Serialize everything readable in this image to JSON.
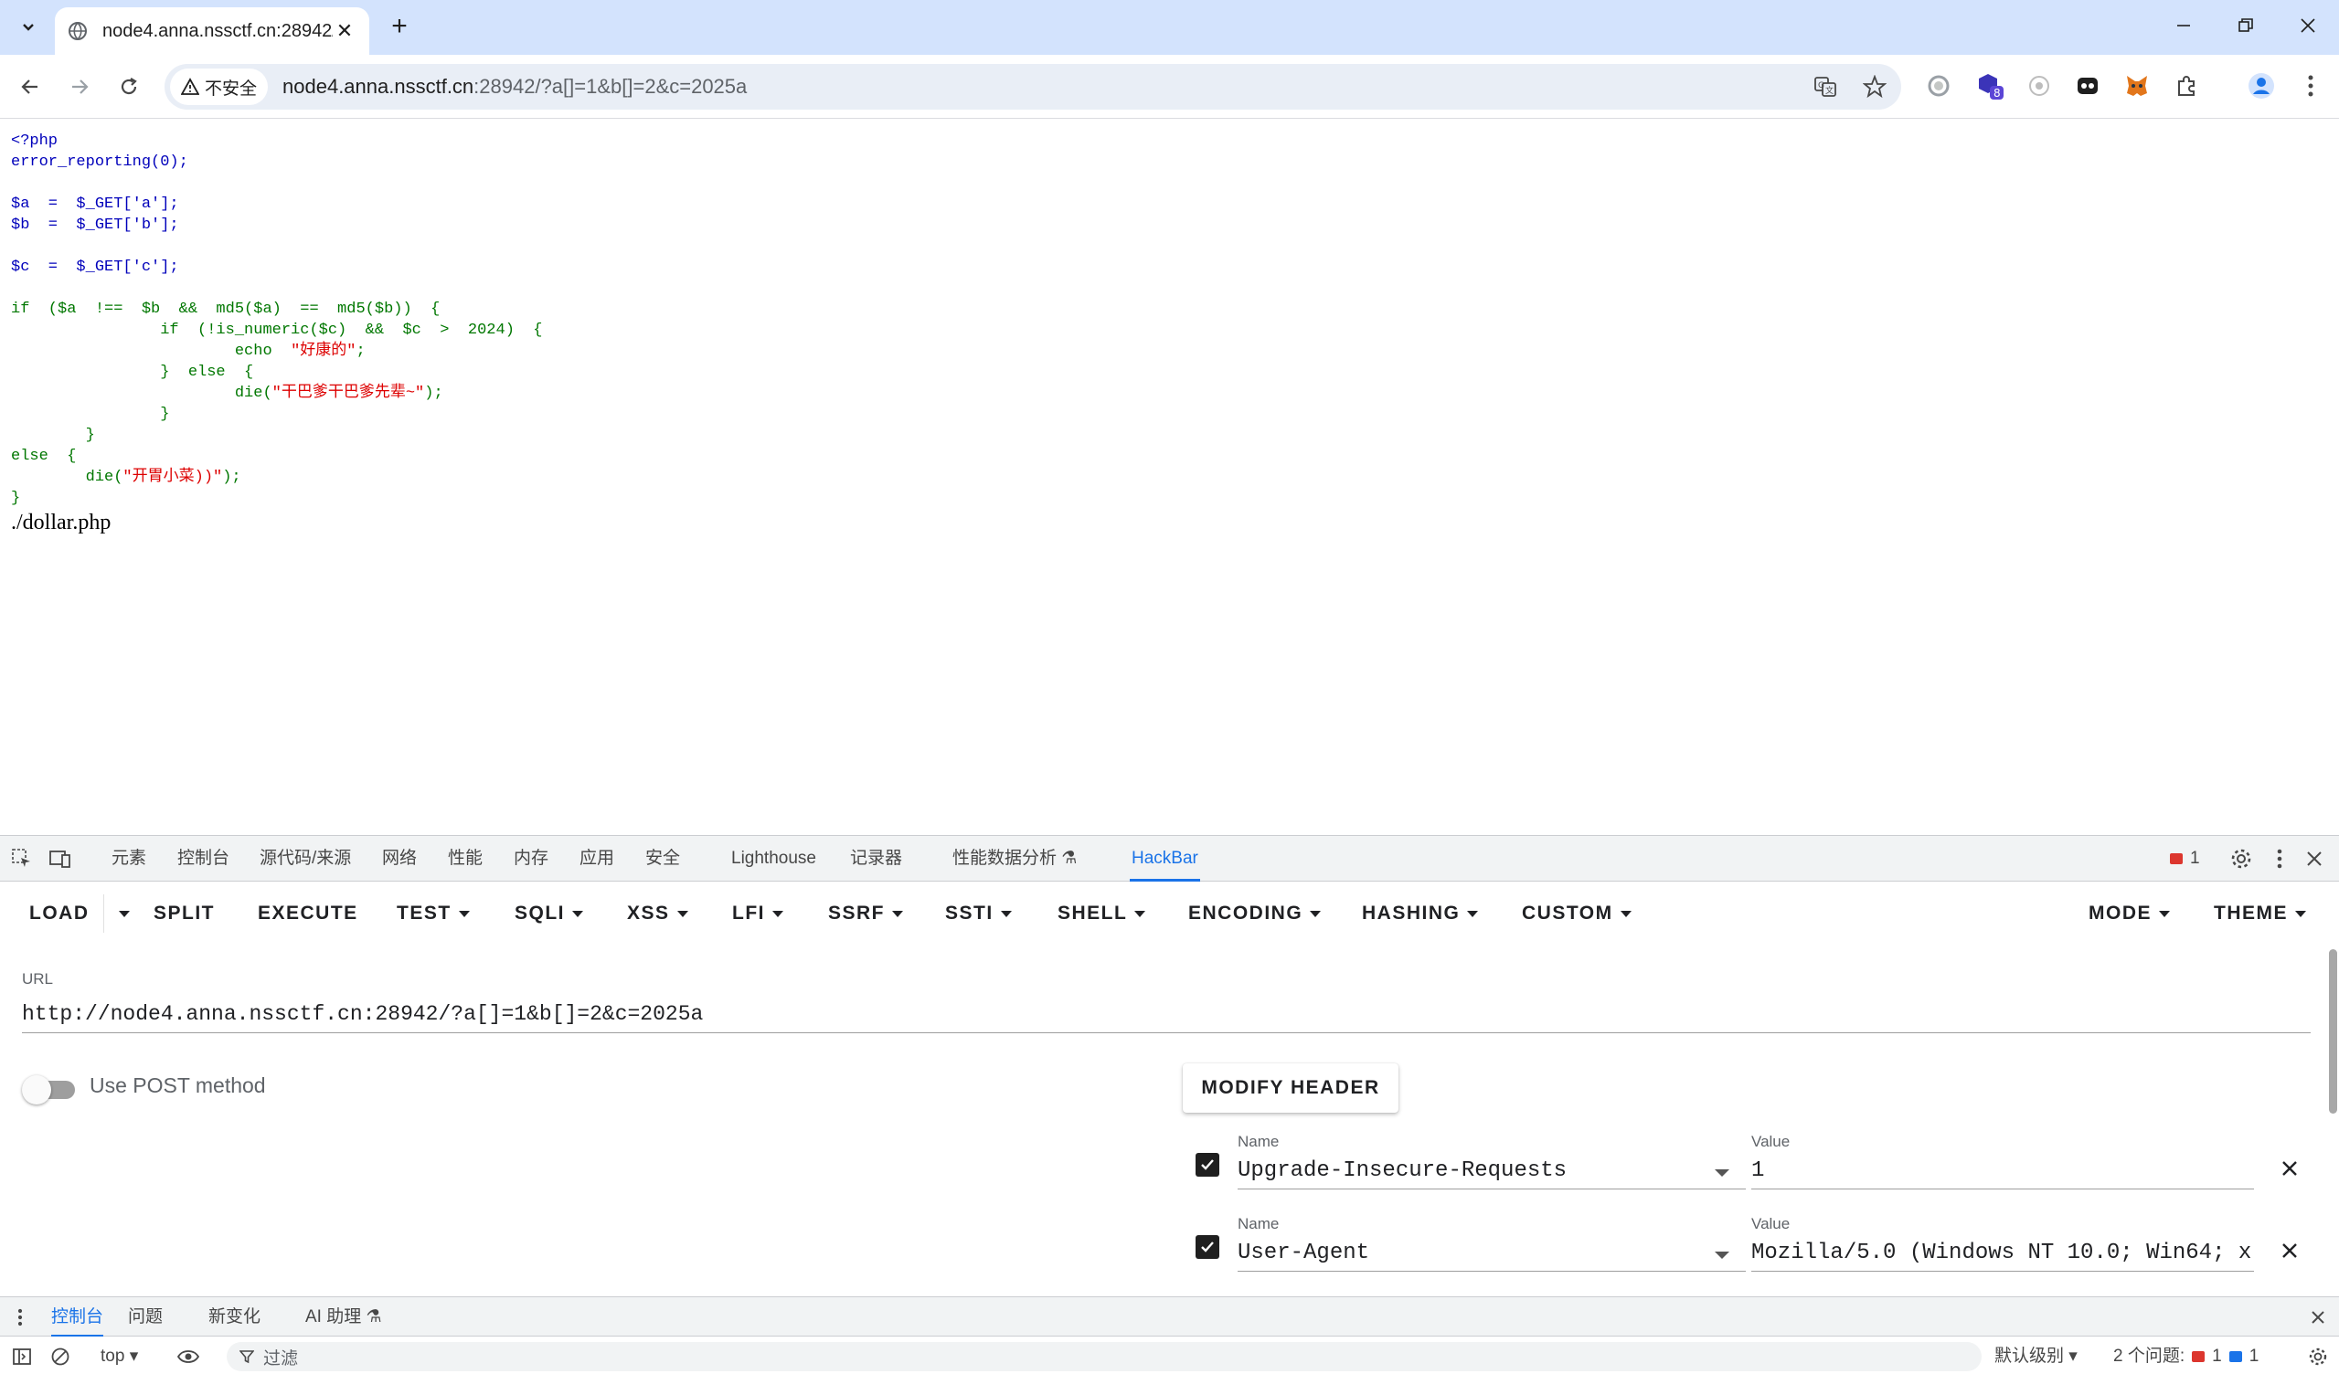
{
  "browser": {
    "tab_title": "node4.anna.nssctf.cn:28942/",
    "security_chip": "不安全",
    "url_host": "node4.anna.nssctf.cn",
    "url_rest": ":28942/?a[]=1&b[]=2&c=2025a",
    "extension_badge": "8"
  },
  "page": {
    "code_lines": [
      "<?php",
      "error_reporting(0);",
      "",
      "$a  =  $_GET['a'];",
      "$b  =  $_GET['b'];",
      "",
      "$c  =  $_GET['c'];",
      "",
      "if  ($a  !==  $b  &&  md5($a)  ==  md5($b))  {",
      "                if  (!is_numeric($c)  &&  $c  >  2024)  {",
      "                        echo  \"好康的\";",
      "                }  else  {",
      "                        die(\"干巴爹干巴爹先辈~\");",
      "                }",
      "        }",
      "else  {",
      "        die(\"开胃小菜))\");",
      "}"
    ],
    "output": "./dollar.php"
  },
  "devtools": {
    "tabs": [
      "元素",
      "控制台",
      "源代码/来源",
      "网络",
      "性能",
      "内存",
      "应用",
      "安全",
      "Lighthouse",
      "记录器",
      "性能数据分析",
      "HackBar"
    ],
    "active_tab": "HackBar",
    "error_count": "1",
    "hackbar": {
      "buttons": {
        "load": "LOAD",
        "split": "SPLIT",
        "execute": "EXECUTE",
        "test": "TEST",
        "sqli": "SQLI",
        "xss": "XSS",
        "lfi": "LFI",
        "ssrf": "SSRF",
        "ssti": "SSTI",
        "shell": "SHELL",
        "encoding": "ENCODING",
        "hashing": "HASHING",
        "custom": "CUSTOM",
        "mode": "MODE",
        "theme": "THEME"
      },
      "url_label": "URL",
      "url_value": "http://node4.anna.nssctf.cn:28942/?a[]=1&b[]=2&c=2025a",
      "post_label": "Use POST method",
      "post_enabled": false,
      "modify_header": "MODIFY HEADER",
      "headers": [
        {
          "name_label": "Name",
          "name": "Upgrade-Insecure-Requests",
          "value_label": "Value",
          "value": "1",
          "checked": true
        },
        {
          "name_label": "Name",
          "name": "User-Agent",
          "value_label": "Value",
          "value": "Mozilla/5.0 (Windows NT 10.0; Win64; x",
          "checked": true
        }
      ]
    },
    "drawer": {
      "tabs": [
        "控制台",
        "问题",
        "新变化",
        "AI 助理"
      ],
      "active_tab": "控制台",
      "context": "top",
      "filter_placeholder": "过滤",
      "level": "默认级别",
      "issues_label": "2 个问题:",
      "issues_error": "1",
      "issues_info": "1"
    }
  },
  "colors": {
    "tabstrip": "#d3e3fd",
    "accent": "#1a73e8",
    "php_keyword": "#007700",
    "php_default": "#0000bb",
    "php_string": "#dd0000"
  }
}
